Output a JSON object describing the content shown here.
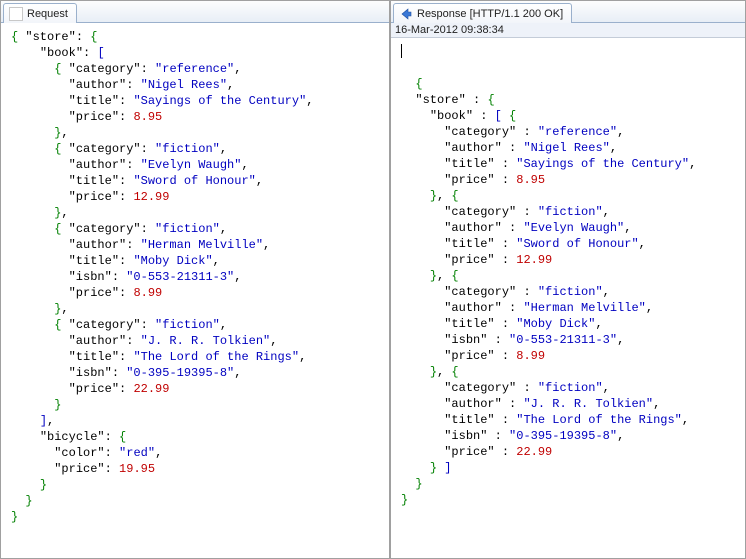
{
  "left_pane": {
    "tab_label": "Request",
    "tab_icon": "blank-icon",
    "json": {
      "store": {
        "book": [
          {
            "category": "reference",
            "author": "Nigel Rees",
            "title": "Sayings of the Century",
            "price": 8.95
          },
          {
            "category": "fiction",
            "author": "Evelyn Waugh",
            "title": "Sword of Honour",
            "price": 12.99
          },
          {
            "category": "fiction",
            "author": "Herman Melville",
            "title": "Moby Dick",
            "isbn": "0-553-21311-3",
            "price": 8.99
          },
          {
            "category": "fiction",
            "author": "J. R. R. Tolkien",
            "title": "The Lord of the Rings",
            "isbn": "0-395-19395-8",
            "price": 22.99
          }
        ],
        "bicycle": {
          "color": "red",
          "price": 19.95
        }
      }
    }
  },
  "right_pane": {
    "tab_label": "Response [HTTP/1.1 200 OK]",
    "tab_icon": "arrow-left-icon",
    "timestamp": "16-Mar-2012 09:38:34",
    "json": {
      "store": {
        "book": [
          {
            "category": "reference",
            "author": "Nigel Rees",
            "title": "Sayings of the Century",
            "price": 8.95
          },
          {
            "category": "fiction",
            "author": "Evelyn Waugh",
            "title": "Sword of Honour",
            "price": 12.99
          },
          {
            "category": "fiction",
            "author": "Herman Melville",
            "title": "Moby Dick",
            "isbn": "0-553-21311-3",
            "price": 8.99
          },
          {
            "category": "fiction",
            "author": "J. R. R. Tolkien",
            "title": "The Lord of the Rings",
            "isbn": "0-395-19395-8",
            "price": 22.99
          }
        ]
      }
    }
  }
}
